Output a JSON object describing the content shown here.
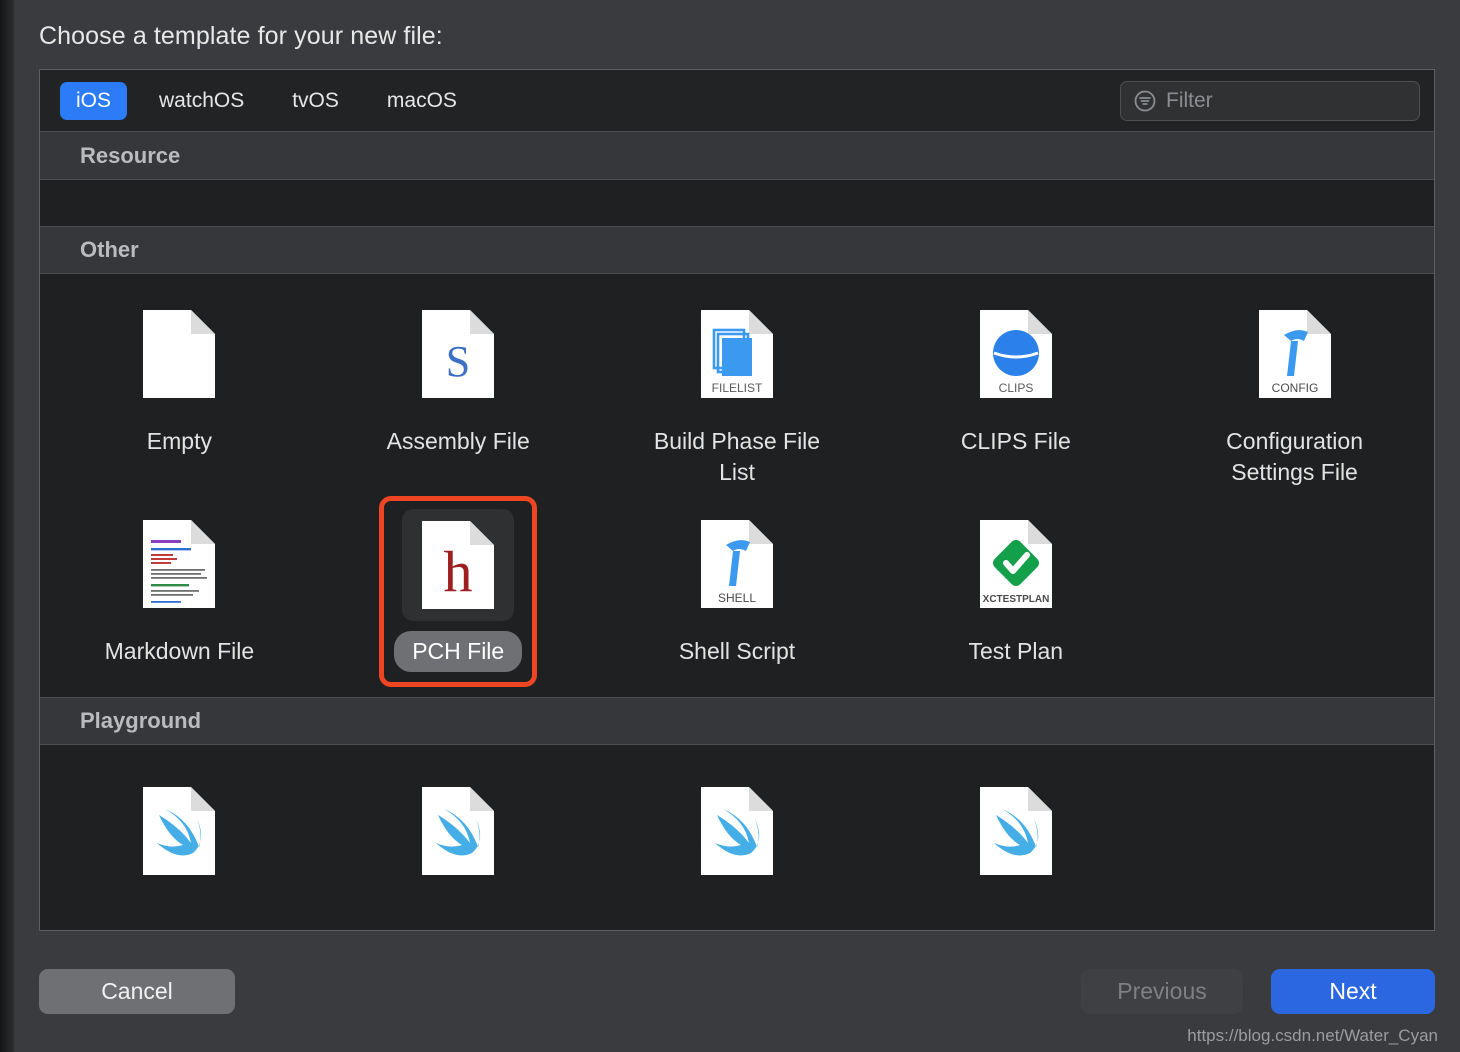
{
  "dialog": {
    "title": "Choose a template for your new file:"
  },
  "tabs": [
    {
      "label": "iOS",
      "active": true
    },
    {
      "label": "watchOS",
      "active": false
    },
    {
      "label": "tvOS",
      "active": false
    },
    {
      "label": "macOS",
      "active": false
    }
  ],
  "filter": {
    "icon": "filter-icon",
    "value": "",
    "placeholder": "Filter"
  },
  "sections": [
    {
      "title": "Resource",
      "items": []
    },
    {
      "title": "Other",
      "items": [
        {
          "label": "Empty",
          "icon": "blank-document-icon",
          "badge": "",
          "selected": false
        },
        {
          "label": "Assembly File",
          "icon": "assembly-document-icon",
          "badge": "S",
          "selected": false
        },
        {
          "label": "Build Phase File List",
          "icon": "filelist-document-icon",
          "badge": "FILELIST",
          "selected": false
        },
        {
          "label": "CLIPS File",
          "icon": "clips-document-icon",
          "badge": "CLIPS",
          "selected": false
        },
        {
          "label": "Configuration Settings File",
          "icon": "config-document-icon",
          "badge": "CONFIG",
          "selected": false
        },
        {
          "label": "Markdown File",
          "icon": "markdown-document-icon",
          "badge": "",
          "selected": false
        },
        {
          "label": "PCH File",
          "icon": "pch-document-icon",
          "badge": "h",
          "selected": true
        },
        {
          "label": "Shell Script",
          "icon": "shell-document-icon",
          "badge": "SHELL",
          "selected": false
        },
        {
          "label": "Test Plan",
          "icon": "testplan-document-icon",
          "badge": "XCTESTPLAN",
          "selected": false
        }
      ]
    },
    {
      "title": "Playground",
      "items": [
        {
          "label": "",
          "icon": "swift-playground-icon",
          "badge": "",
          "selected": false
        },
        {
          "label": "",
          "icon": "swift-playground-icon",
          "badge": "",
          "selected": false
        },
        {
          "label": "",
          "icon": "swift-playground-icon",
          "badge": "",
          "selected": false
        },
        {
          "label": "",
          "icon": "swift-playground-icon",
          "badge": "",
          "selected": false
        }
      ]
    }
  ],
  "footer": {
    "cancel_label": "Cancel",
    "previous_label": "Previous",
    "next_label": "Next"
  },
  "watermark": "https://blog.csdn.net/Water_Cyan",
  "colors": {
    "accent_blue": "#2b7cf6",
    "next_blue": "#2b67e0",
    "selection_red": "#ee4523",
    "dialog_bg": "#3a3b3e",
    "panel_bg": "#1f2021",
    "section_header_bg": "#35373a"
  }
}
